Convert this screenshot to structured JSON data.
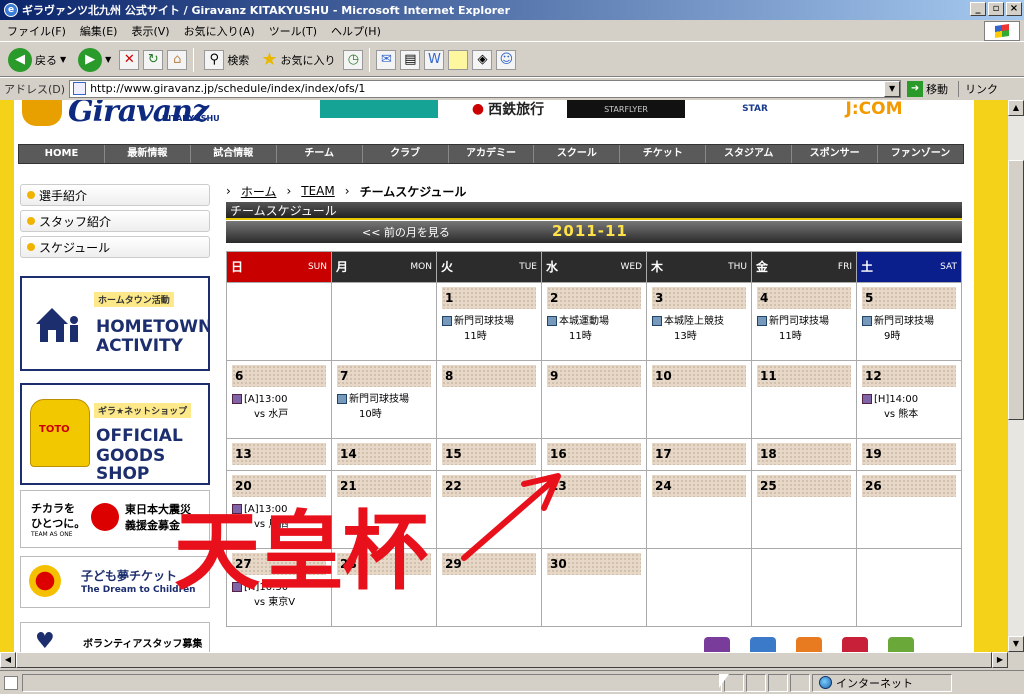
{
  "window": {
    "title": "ギラヴァンツ北九州 公式サイト / Giravanz KITAKYUSHU - Microsoft Internet Explorer",
    "buttons": [
      "_",
      "▫",
      "×"
    ]
  },
  "menu": [
    "ファイル(F)",
    "編集(E)",
    "表示(V)",
    "お気に入り(A)",
    "ツール(T)",
    "ヘルプ(H)"
  ],
  "toolbar": {
    "back": "戻る",
    "search": "検索",
    "favorites": "お気に入り"
  },
  "address": {
    "label": "アドレス(D)",
    "url": "http://www.giravanz.jp/schedule/index/index/ofs/1",
    "go": "移動",
    "links": "リンク"
  },
  "site": {
    "logo_word": "Giravanz",
    "logo_sub": "KITAKYUSHU",
    "sponsors": [
      "西鉄旅行",
      "STARFLYER",
      "STAR",
      "J:COM"
    ]
  },
  "nav": [
    "HOME",
    "最新情報",
    "試合情報",
    "チーム",
    "クラブ",
    "アカデミー",
    "スクール",
    "チケット",
    "スタジアム",
    "スポンサー",
    "ファンゾーン"
  ],
  "sidebar": {
    "items": [
      "選手紹介",
      "スタッフ紹介",
      "スケジュール"
    ],
    "banners": {
      "hometown_kicker": "ホームタウン活動",
      "hometown_line1": "HOMETOWN",
      "hometown_line2": "ACTIVITY",
      "shop_kicker": "ギラ★ネットショップ",
      "shop_line1": "OFFICIAL",
      "shop_line2": "GOODS SHOP",
      "shirt_text": "TOTO",
      "quake_left1": "チカラを",
      "quake_left2": "ひとつに。",
      "quake_left3": "TEAM AS ONE",
      "quake_right1": "東日本大震災",
      "quake_right2": "義援金募金",
      "dream_title": "子ども夢チケット",
      "dream_sub": "The Dream to Children",
      "volunteer": "ボランティアスタッフ募集"
    }
  },
  "main": {
    "breadcrumb": [
      "ホーム",
      "TEAM",
      "チームスケジュール"
    ],
    "section_title": "チームスケジュール",
    "prev_month": "<<  前の月を見る",
    "year_month": "2011-11",
    "weekdays": [
      {
        "ja": "日",
        "en": "SUN"
      },
      {
        "ja": "月",
        "en": "MON"
      },
      {
        "ja": "火",
        "en": "TUE"
      },
      {
        "ja": "水",
        "en": "WED"
      },
      {
        "ja": "木",
        "en": "THU"
      },
      {
        "ja": "金",
        "en": "FRI"
      },
      {
        "ja": "土",
        "en": "SAT"
      }
    ],
    "weeks": [
      [
        {
          "day": "",
          "events": []
        },
        {
          "day": "",
          "events": []
        },
        {
          "day": "1",
          "events": [
            {
              "kind": "practice",
              "line1": "新門司球技場",
              "line2": "11時"
            }
          ]
        },
        {
          "day": "2",
          "events": [
            {
              "kind": "practice",
              "line1": "本城運動場",
              "line2": "11時"
            }
          ]
        },
        {
          "day": "3",
          "events": [
            {
              "kind": "practice",
              "line1": "本城陸上競技",
              "line2": "13時"
            }
          ]
        },
        {
          "day": "4",
          "events": [
            {
              "kind": "practice",
              "line1": "新門司球技場",
              "line2": "11時"
            }
          ]
        },
        {
          "day": "5",
          "events": [
            {
              "kind": "practice",
              "line1": "新門司球技場",
              "line2": "9時"
            }
          ]
        }
      ],
      [
        {
          "day": "6",
          "events": [
            {
              "kind": "match",
              "line1": "[A]13:00",
              "line2": "vs 水戸"
            }
          ]
        },
        {
          "day": "7",
          "events": [
            {
              "kind": "practice",
              "line1": "新門司球技場",
              "line2": "10時"
            }
          ]
        },
        {
          "day": "8",
          "events": []
        },
        {
          "day": "9",
          "events": []
        },
        {
          "day": "10",
          "events": []
        },
        {
          "day": "11",
          "events": []
        },
        {
          "day": "12",
          "events": [
            {
              "kind": "match",
              "line1": "[H]14:00",
              "line2": "vs 熊本"
            }
          ]
        }
      ],
      [
        {
          "day": "13",
          "events": []
        },
        {
          "day": "14",
          "events": []
        },
        {
          "day": "15",
          "events": []
        },
        {
          "day": "16",
          "events": []
        },
        {
          "day": "17",
          "events": []
        },
        {
          "day": "18",
          "events": []
        },
        {
          "day": "19",
          "events": []
        }
      ],
      [
        {
          "day": "20",
          "events": [
            {
              "kind": "match",
              "line1": "[A]13:00",
              "line2": "vs 鳥栖"
            }
          ]
        },
        {
          "day": "21",
          "events": []
        },
        {
          "day": "22",
          "events": []
        },
        {
          "day": "23",
          "events": []
        },
        {
          "day": "24",
          "events": []
        },
        {
          "day": "25",
          "events": []
        },
        {
          "day": "26",
          "events": []
        }
      ],
      [
        {
          "day": "27",
          "events": [
            {
              "kind": "match",
              "line1": "[H]16:30",
              "line2": "vs 東京V"
            }
          ]
        },
        {
          "day": "28",
          "events": []
        },
        {
          "day": "29",
          "events": []
        },
        {
          "day": "30",
          "events": []
        },
        {
          "day": "",
          "events": []
        },
        {
          "day": "",
          "events": []
        },
        {
          "day": "",
          "events": []
        }
      ]
    ]
  },
  "annotation": {
    "text": "天皇杯",
    "color": "#e8101a"
  },
  "status": {
    "zone": "インターネット"
  },
  "colors": {
    "title_bar": "#0a246a",
    "page_frame": "#f5d21a",
    "sunday": "#c80000",
    "saturday": "#0a1e8c",
    "year_month": "#ffe24a"
  }
}
